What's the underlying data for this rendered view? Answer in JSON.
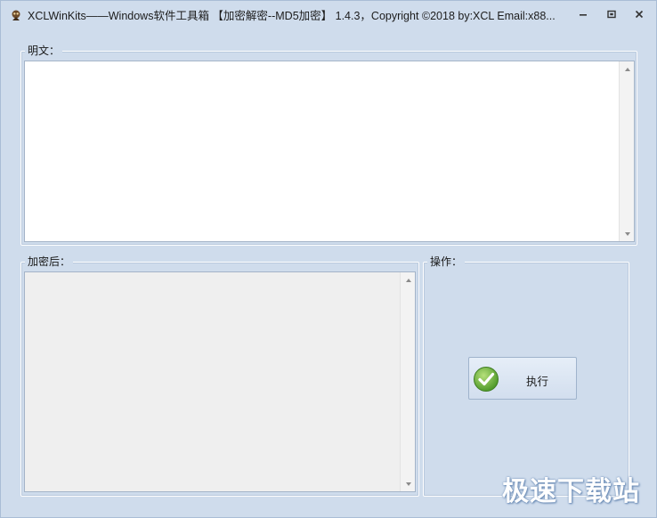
{
  "window": {
    "title": "XCLWinKits——Windows软件工具箱 【加密解密--MD5加密】 1.4.3，Copyright ©2018 by:XCL Email:x88...",
    "icons": {
      "app": "app-logo-icon",
      "minimize": "minimize-icon",
      "maximize": "maximize-icon",
      "close": "close-icon"
    }
  },
  "plaintext": {
    "legend": "明文：",
    "value": ""
  },
  "ciphertext": {
    "legend": "加密后：",
    "value": ""
  },
  "operations": {
    "legend": "操作：",
    "execute_label": "执行",
    "execute_icon": "checkmark-icon"
  },
  "watermark": {
    "text": "极速下载站"
  },
  "colors": {
    "window_bg": "#cfdcec",
    "check_green": "#6db33f"
  }
}
